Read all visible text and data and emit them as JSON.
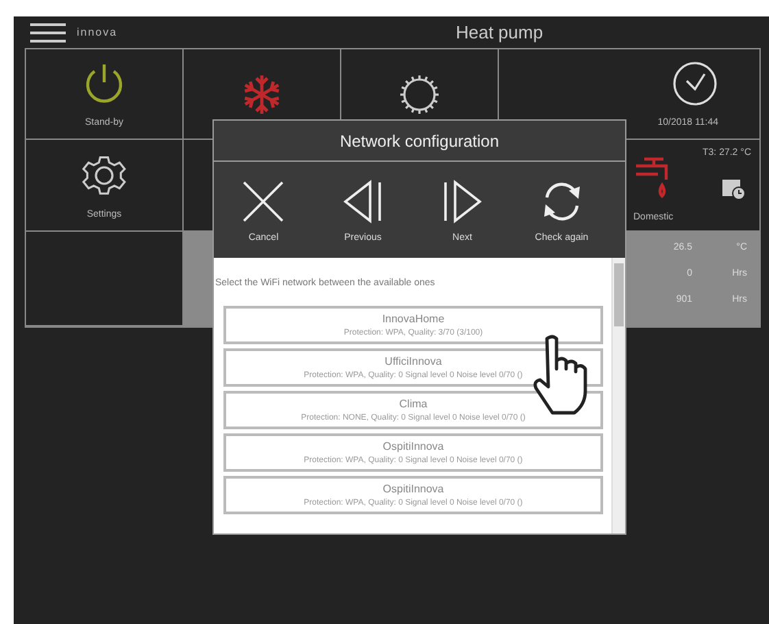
{
  "header": {
    "logo": "innova",
    "title": "Heat pump"
  },
  "tiles": [
    {
      "label": "Stand-by"
    },
    {
      "label": "Settings"
    }
  ],
  "clock": {
    "datetime": "10/2018 11:44"
  },
  "hot_water": {
    "label": "Domestic",
    "temperature": "T3: 27.2 °C"
  },
  "readings": [
    {
      "value": "26.5",
      "unit": "°C"
    },
    {
      "value": "0",
      "unit": "Hrs"
    },
    {
      "value": "901",
      "unit": "Hrs"
    }
  ],
  "dialog": {
    "title": "Network configuration",
    "actions": [
      {
        "label": "Cancel"
      },
      {
        "label": "Previous"
      },
      {
        "label": "Next"
      },
      {
        "label": "Check again"
      }
    ],
    "prompt": "Select the WiFi network between the available ones",
    "networks": [
      {
        "name": "InnovaHome",
        "details": "Protection: WPA, Quality: 3/70 (3/100)"
      },
      {
        "name": "UfficiInnova",
        "details": "Protection: WPA, Quality: 0 Signal level 0 Noise level 0/70 ()"
      },
      {
        "name": "Clima",
        "details": "Protection: NONE, Quality: 0 Signal level 0 Noise level 0/70 ()"
      },
      {
        "name": "OspitiInnova",
        "details": "Protection: WPA, Quality: 0 Signal level 0 Noise level 0/70 ()"
      },
      {
        "name": "OspitiInnova",
        "details": "Protection: WPA, Quality: 0 Signal level 0 Noise level 0/70 ()"
      }
    ]
  }
}
